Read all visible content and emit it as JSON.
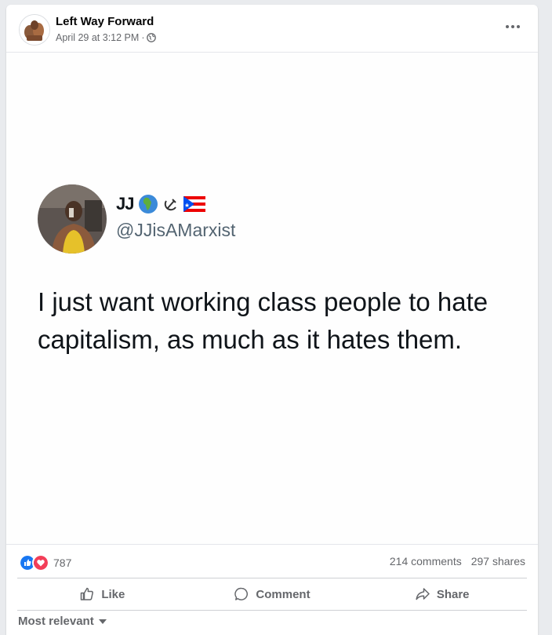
{
  "post": {
    "page_name": "Left Way Forward",
    "timestamp": "April 29 at 3:12 PM",
    "separator": "·",
    "privacy_icon": "globe-icon",
    "more_icon": "more-options-icon"
  },
  "tweet": {
    "display_name": "JJ",
    "name_emojis": [
      "globe-africa-icon",
      "hammer-sickle-icon",
      "puerto-rico-flag-icon"
    ],
    "handle": "@JJisAMarxist",
    "text": "I just want working class people to hate capitalism, as much as it hates them."
  },
  "engagement": {
    "reactions": [
      "like-reaction-icon",
      "love-reaction-icon"
    ],
    "reaction_count": "787",
    "comments": "214 comments",
    "shares": "297 shares"
  },
  "actions": {
    "like": "Like",
    "comment": "Comment",
    "share": "Share"
  },
  "comments_sort": {
    "label": "Most relevant"
  },
  "colors": {
    "like_blue": "#1877f2",
    "love_red": "#f33e58",
    "secondary_text": "#65676b"
  }
}
